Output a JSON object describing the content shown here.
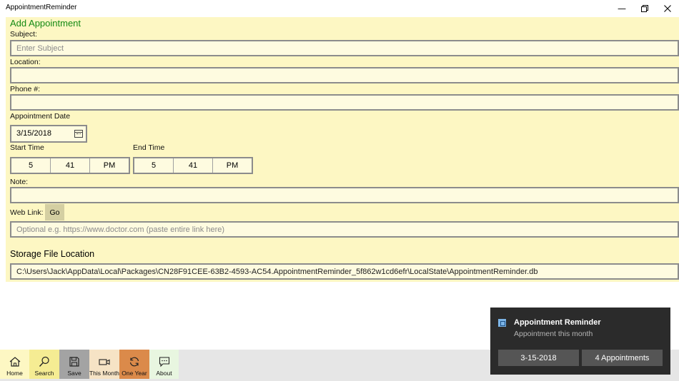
{
  "window": {
    "title": "AppointmentReminder"
  },
  "form": {
    "title": "Add Appointment",
    "subject": {
      "label": "Subject:",
      "placeholder": "Enter Subject",
      "value": ""
    },
    "location": {
      "label": "Location:",
      "value": ""
    },
    "phone": {
      "label": "Phone #:",
      "value": ""
    },
    "date": {
      "label": "Appointment Date",
      "value": "3/15/2018"
    },
    "start_time": {
      "label": "Start Time",
      "hour": "5",
      "minute": "41",
      "period": "PM"
    },
    "end_time": {
      "label": "End Time",
      "hour": "5",
      "minute": "41",
      "period": "PM"
    },
    "note": {
      "label": "Note:",
      "value": ""
    },
    "web_link": {
      "label": "Web Link:",
      "go_label": "Go",
      "placeholder": "Optional e.g. https://www.doctor.com (paste entire link here)"
    },
    "storage": {
      "title": "Storage File Location",
      "path": "C:\\Users\\Jack\\AppData\\Local\\Packages\\CN28F91CEE-63B2-4593-AC54.AppointmentReminder_5f862w1cd6efr\\LocalState\\AppointmentReminder.db"
    }
  },
  "nav": [
    {
      "label": "Home",
      "icon": "home-icon",
      "bg": "#fdf7c3"
    },
    {
      "label": "Search",
      "icon": "search-icon",
      "bg": "#f5ec93"
    },
    {
      "label": "Save",
      "icon": "save-icon",
      "bg": "#a3a3a3"
    },
    {
      "label": "This Month",
      "icon": "camera-icon",
      "bg": "#f6e3c5"
    },
    {
      "label": "One Year",
      "icon": "refresh-icon",
      "bg": "#db8a4a"
    },
    {
      "label": "About",
      "icon": "chat-icon",
      "bg": "#e8f6e0"
    }
  ],
  "toast": {
    "title": "Appointment Reminder",
    "subtitle": "Appointment this month",
    "date_button": "3-15-2018",
    "count_button": "4 Appointments"
  },
  "colors": {
    "form_bg": "#fdf7c3",
    "title_green": "#138a13",
    "toast_bg": "#2b2b2b"
  }
}
